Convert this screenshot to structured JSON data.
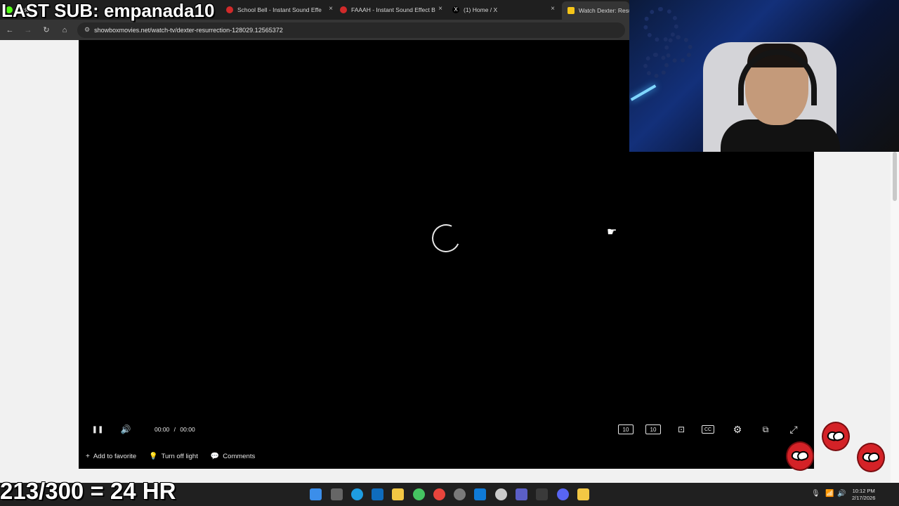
{
  "browser": {
    "tabs": [
      {
        "title": "Kick",
        "close": "×"
      },
      {
        "title": "School Bell - Instant Sound Effe",
        "close": "×"
      },
      {
        "title": "FAAAH - Instant Sound Effect B",
        "close": "×"
      },
      {
        "title": "(1) Home / X",
        "close": "×"
      },
      {
        "title": "Watch Dexter: Resurr",
        "close": ""
      }
    ],
    "nav": {
      "back": "←",
      "forward": "→",
      "reload": "↻",
      "home": "⌂"
    },
    "address": {
      "tune_icon": "⚙",
      "url": "showboxmovies.net/watch-tv/dexter-resurrection-128029.12565372"
    }
  },
  "player": {
    "state": "loading",
    "controls": {
      "pause": "❚❚",
      "volume": "🔊",
      "current_time": "00:00",
      "separator": "/",
      "duration": "00:00",
      "rewind": "10",
      "forward": "10",
      "cast": "⊡",
      "captions": "CC",
      "settings": "⚙",
      "pip": "⧉",
      "fullscreen": "⤢"
    }
  },
  "actions": [
    {
      "icon": "+",
      "label": "Add to favorite"
    },
    {
      "icon": "💡",
      "label": "Turn off light"
    },
    {
      "icon": "💬",
      "label": "Comments"
    }
  ],
  "overlay": {
    "last_sub": "LAST SUB: empanada10",
    "counter": "213/300 = 24 HR"
  },
  "taskbar": {
    "colors": [
      "#3b8eea",
      "#666666",
      "#1e9de0",
      "#0f6cbd",
      "#f2c744",
      "#45c461",
      "#e8453c",
      "#7a7a7a",
      "#0f7bd8",
      "#cccccc",
      "#5b5fc7",
      "#3a3a3a",
      "#5865f2",
      "#f2c744"
    ],
    "tray": {
      "mic": "🎙",
      "wifi": "📶",
      "volume": "🔊"
    },
    "time": "10:12 PM",
    "date": "2/17/2026"
  },
  "cursor": "☛"
}
